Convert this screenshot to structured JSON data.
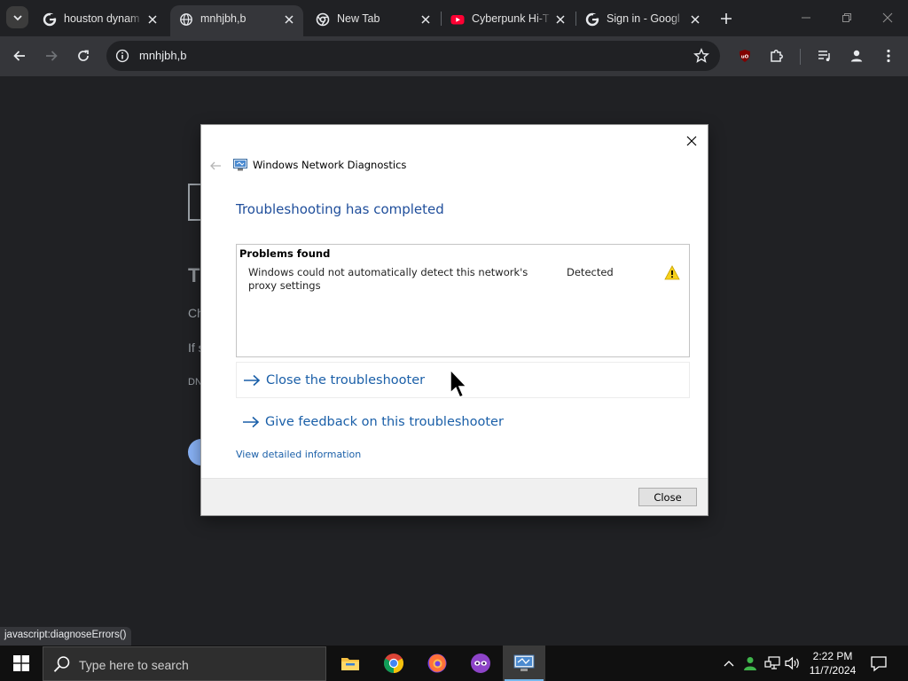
{
  "browser": {
    "tabs": [
      {
        "title": "houston dynam",
        "icon": "google-icon"
      },
      {
        "title": "mnhjbh,b",
        "icon": "globe-icon",
        "active": true
      },
      {
        "title": "New Tab",
        "icon": "chrome-icon"
      },
      {
        "title": "Cyberpunk Hi-T",
        "icon": "youtube-icon"
      },
      {
        "title": "Sign in - Googl",
        "icon": "google-icon"
      }
    ],
    "address": "mnhjbh,b",
    "status_url": "javascript:diagnoseErrors()"
  },
  "error_page_fragments": {
    "heading_fragment": "T",
    "line1_fragment": "Ch",
    "line2_fragment": "If s",
    "code_fragment": "DN"
  },
  "dialog": {
    "window_title": "Windows Network Diagnostics",
    "heading": "Troubleshooting has completed",
    "problems_header": "Problems found",
    "problems": [
      {
        "description": "Windows could not automatically detect this network's proxy settings",
        "status": "Detected",
        "icon": "warning-icon"
      }
    ],
    "commands": [
      {
        "label": "Close the troubleshooter"
      },
      {
        "label": "Give feedback on this troubleshooter"
      }
    ],
    "detail_link": "View detailed information",
    "close_button": "Close"
  },
  "taskbar": {
    "search_placeholder": "Type here to search",
    "apps": [
      "file-explorer-icon",
      "chrome-icon",
      "firefox-icon",
      "game-icon",
      "network-diagnostics-icon"
    ],
    "time": "2:22 PM",
    "date": "11/7/2024"
  },
  "colors": {
    "accent_link": "#1a5fa8",
    "heading": "#1f4e9b",
    "browser_bg": "#202124",
    "toolbar_bg": "#35363a"
  }
}
